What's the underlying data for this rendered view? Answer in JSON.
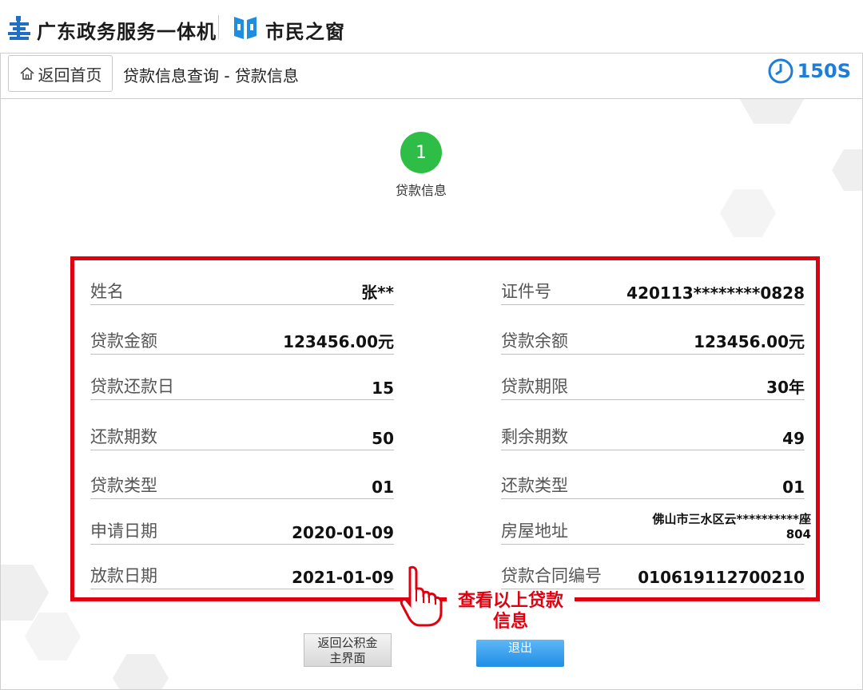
{
  "brand": {
    "title": "广东政务服务一体机",
    "window_title": "市民之窗"
  },
  "header": {
    "home_label": "返回首页",
    "breadcrumb": "贷款信息查询 - 贷款信息",
    "timer": "150S"
  },
  "step": {
    "number": "1",
    "label": "贷款信息"
  },
  "info": {
    "left": [
      {
        "label": "姓名",
        "value": "张**"
      },
      {
        "label": "贷款金额",
        "value": "123456.00元"
      },
      {
        "label": "贷款还款日",
        "value": "15"
      },
      {
        "label": "还款期数",
        "value": "50"
      },
      {
        "label": "贷款类型",
        "value": "01"
      },
      {
        "label": "申请日期",
        "value": "2020-01-09"
      },
      {
        "label": "放款日期",
        "value": "2021-01-09"
      }
    ],
    "right": [
      {
        "label": "证件号",
        "value": "420113********0828"
      },
      {
        "label": "贷款余额",
        "value": "123456.00元"
      },
      {
        "label": "贷款期限",
        "value": "30年"
      },
      {
        "label": "剩余期数",
        "value": "49"
      },
      {
        "label": "还款类型",
        "value": "01"
      },
      {
        "label": "房屋地址",
        "value_line1": "佛山市三水区云**********座",
        "value_line2": "804"
      },
      {
        "label": "贷款合同编号",
        "value": "010619112700210"
      }
    ]
  },
  "annotation": {
    "line1": "查看以上贷款",
    "line2": "信息"
  },
  "buttons": {
    "back_line1": "返回公积金",
    "back_line2": "主界面",
    "exit": "退出"
  },
  "colors": {
    "accent_blue": "#1f7dd6",
    "step_green": "#2ebd47",
    "highlight_red": "#e00010"
  }
}
